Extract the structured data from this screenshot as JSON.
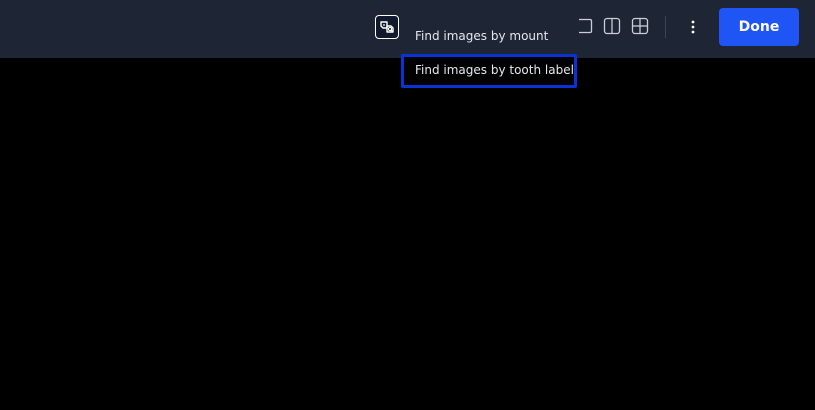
{
  "toolbar": {
    "find_icon": "find-images-icon",
    "layout_icons": [
      "single-layout-icon",
      "two-column-layout-icon",
      "grid-layout-icon"
    ],
    "more_icon": "more-vertical-icon",
    "done_label": "Done"
  },
  "find_menu": {
    "items": [
      {
        "label": "Find images by mount"
      },
      {
        "label": "Find images by tooth label"
      }
    ]
  },
  "colors": {
    "toolbar_bg": "#1e2636",
    "viewer_bg": "#000000",
    "accent": "#1f54f5",
    "focus_ring": "#0a33d6"
  }
}
